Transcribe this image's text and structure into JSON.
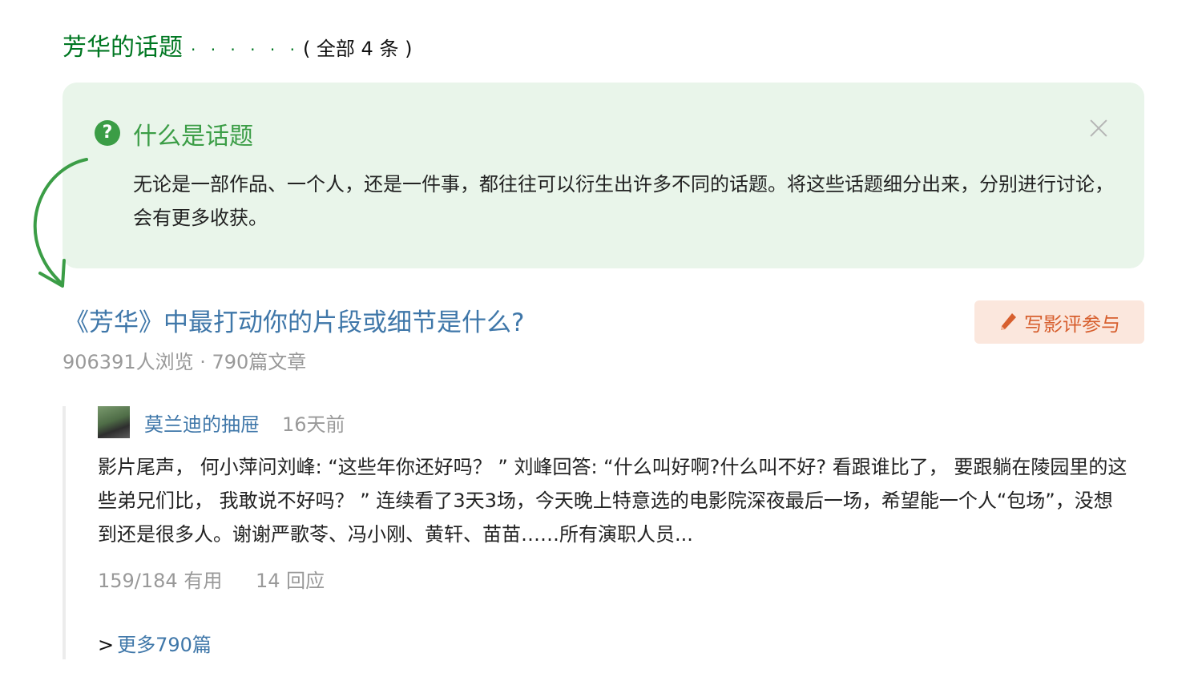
{
  "section": {
    "title": "芳华的话题",
    "dots": "· · · · · ·",
    "count": "( 全部 4 条 )"
  },
  "tip": {
    "icon": "question-circle-icon",
    "title": "什么是话题",
    "text": "无论是一部作品、一个人，还是一件事，都往往可以衍生出许多不同的话题。将这些话题细分出来，分别进行讨论，会有更多收获。",
    "close_icon": "close-icon"
  },
  "topic": {
    "title": "《芳华》中最打动你的片段或细节是什么?",
    "meta": "906391人浏览 · 790篇文章",
    "write_button": "写影评参与"
  },
  "review": {
    "author": "莫兰迪的抽屉",
    "time": "16天前",
    "text": "影片尾声， 何小萍问刘峰: “这些年你还好吗？ ” 刘峰回答: “什么叫好啊?什么叫不好? 看跟谁比了， 要跟躺在陵园里的这些弟兄们比， 我敢说不好吗？ ” 连续看了3天3场，今天晚上特意选的电影院深夜最后一场，希望能一个人“包场”，没想到还是很多人。谢谢严歌苓、冯小刚、黄轩、苗苗……所有演职人员...",
    "useful": "159/184 有用",
    "replies": "14 回应"
  },
  "more": {
    "arrow": ">",
    "label": "更多790篇"
  },
  "colors": {
    "green_title": "#007722",
    "tip_bg": "#e9f5ea",
    "tip_accent": "#3b9d46",
    "link_blue": "#3f77a9",
    "button_bg": "#fbe7dd",
    "button_text": "#d75f2e",
    "meta_gray": "#999999"
  }
}
